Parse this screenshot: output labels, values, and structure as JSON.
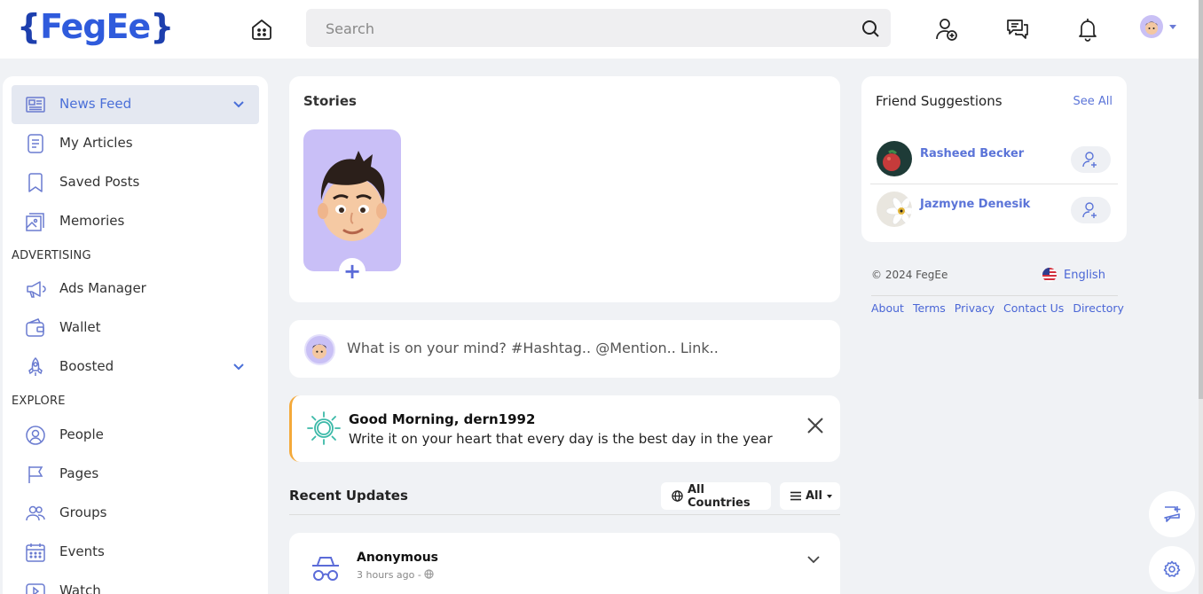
{
  "brand": {
    "logo_text_open": "{",
    "logo_text": "FegEe",
    "logo_text_close": "}"
  },
  "search": {
    "placeholder": "Search"
  },
  "sidebar": {
    "items": [
      {
        "label": "News Feed"
      },
      {
        "label": "My Articles"
      },
      {
        "label": "Saved Posts"
      },
      {
        "label": "Memories"
      },
      {
        "label": "Ads Manager"
      },
      {
        "label": "Wallet"
      },
      {
        "label": "Boosted"
      },
      {
        "label": "People"
      },
      {
        "label": "Pages"
      },
      {
        "label": "Groups"
      },
      {
        "label": "Events"
      },
      {
        "label": "Watch"
      }
    ],
    "sections": {
      "advertising": "ADVERTISING",
      "explore": "EXPLORE"
    }
  },
  "stories": {
    "title": "Stories",
    "add_symbol": "+"
  },
  "composer": {
    "placeholder": "What is on your mind? #Hashtag.. @Mention.. Link.."
  },
  "greeting": {
    "heading": "Good Morning, dern1992",
    "message": "Write it on your heart that every day is the best day in the year"
  },
  "recent": {
    "title": "Recent Updates",
    "filter_countries": "All Countries",
    "filter_all": "All"
  },
  "post": {
    "author": "Anonymous",
    "time": "3 hours ago -"
  },
  "suggestions": {
    "title": "Friend Suggestions",
    "see_all": "See All",
    "people": [
      {
        "name": "Rasheed Becker"
      },
      {
        "name": "Jazmyne Denesik"
      }
    ]
  },
  "footer": {
    "copyright": "© 2024 FegEe",
    "language": "English",
    "links": [
      "About",
      "Terms",
      "Privacy",
      "Contact Us",
      "Directory"
    ]
  },
  "colors": {
    "accent": "#4a6fd8",
    "story_bg": "#c9bff7",
    "greeting_border": "#f4a93a"
  }
}
